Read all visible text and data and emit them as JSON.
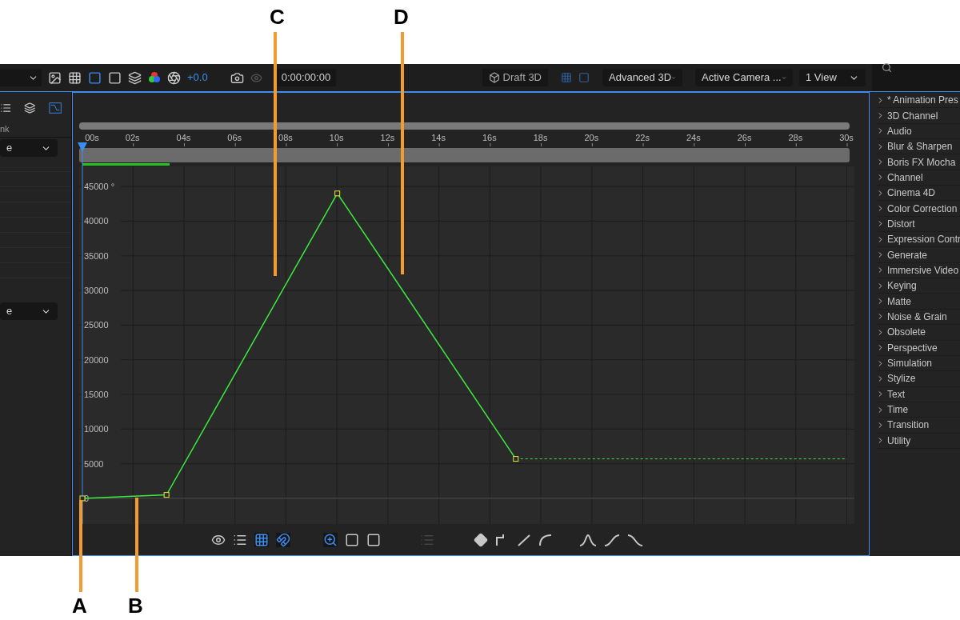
{
  "annotations": [
    {
      "label": "C"
    },
    {
      "label": "D"
    },
    {
      "label": "A"
    },
    {
      "label": "B"
    }
  ],
  "toolbar": {
    "exposure": "+0.0",
    "time": "0:00:00:00",
    "draft_button": "Draft 3D",
    "renderer": "Advanced 3D",
    "camera": "Active Camera ...",
    "views": "1 View"
  },
  "layer_panel": {
    "column_header": "nk",
    "dropdowns": [
      "e",
      "e"
    ]
  },
  "graph_editor": {
    "chart_data": {
      "type": "line",
      "x": [
        0,
        3.3,
        10,
        17,
        30
      ],
      "series": [
        {
          "color": "#3cea3c",
          "line_style": "solid",
          "marker": "square",
          "values": [
            0,
            500,
            44000,
            5700,
            null
          ]
        },
        {
          "color": "#3cea3c",
          "line_style": "dashed",
          "values": [
            null,
            null,
            null,
            5700,
            5700
          ]
        }
      ],
      "xlim": [
        0,
        30
      ],
      "ylim": [
        -3700,
        47900
      ],
      "grid": true,
      "ref_lines": [
        {
          "axis": "y",
          "value": 0
        }
      ],
      "xticks": [
        {
          "value": 0,
          "label": "00s"
        },
        {
          "value": 2,
          "label": "02s"
        },
        {
          "value": 4,
          "label": "04s"
        },
        {
          "value": 6,
          "label": "06s"
        },
        {
          "value": 8,
          "label": "08s"
        },
        {
          "value": 10,
          "label": "10s"
        },
        {
          "value": 12,
          "label": "12s"
        },
        {
          "value": 14,
          "label": "14s"
        },
        {
          "value": 16,
          "label": "16s"
        },
        {
          "value": 18,
          "label": "18s"
        },
        {
          "value": 20,
          "label": "20s"
        },
        {
          "value": 22,
          "label": "22s"
        },
        {
          "value": 24,
          "label": "24s"
        },
        {
          "value": 26,
          "label": "26s"
        },
        {
          "value": 28,
          "label": "28s"
        },
        {
          "value": 30,
          "label": "30s"
        }
      ],
      "yticks": [
        0,
        5000,
        10000,
        15000,
        20000,
        25000,
        30000,
        35000,
        40000,
        {
          "value": 45000,
          "label": "45000 °"
        }
      ]
    }
  },
  "effects_panel": {
    "items": [
      "* Animation Pres",
      "3D Channel",
      "Audio",
      "Blur & Sharpen",
      "Boris FX Mocha",
      "Channel",
      "Cinema 4D",
      "Color Correction",
      "Distort",
      "Expression Contr",
      "Generate",
      "Immersive Video",
      "Keying",
      "Matte",
      "Noise & Grain",
      "Obsolete",
      "Perspective",
      "Simulation",
      "Stylize",
      "Text",
      "Time",
      "Transition",
      "Utility"
    ]
  }
}
